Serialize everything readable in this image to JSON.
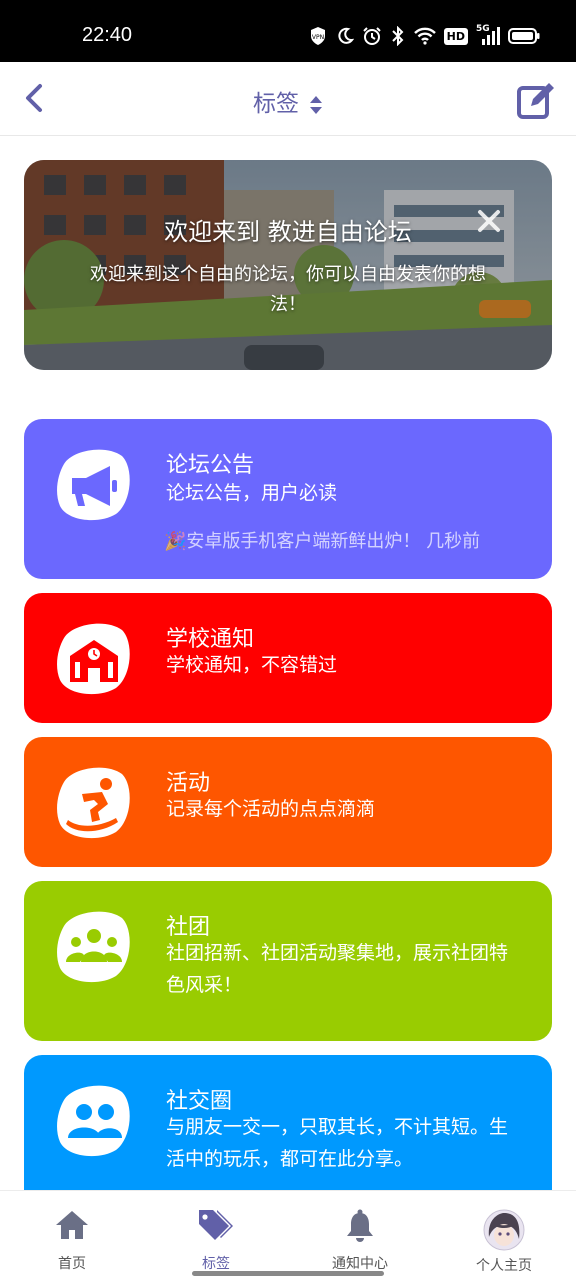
{
  "status_bar": {
    "time": "22:40",
    "icons": [
      "vpn-icon",
      "moon-icon",
      "alarm-icon",
      "bluetooth-icon",
      "wifi-icon",
      "hd-icon",
      "5g-signal-icon",
      "battery-icon"
    ],
    "hd_label": "HD",
    "network_label": "5G"
  },
  "header": {
    "title": "标签",
    "back_icon": "chevron-left-icon",
    "sort_icon": "sort-icon",
    "edit_icon": "edit-icon",
    "accent_color": "#6160a8"
  },
  "banner": {
    "title": "欢迎来到 教进自由论坛",
    "text": "欢迎来到这个自由的论坛，你可以自由发表你的想法！",
    "close_icon": "close-icon"
  },
  "categories": [
    {
      "title": "论坛公告",
      "desc": "论坛公告，用户必读",
      "latest": "🎉安卓版手机客户端新鲜出炉！ 几秒前",
      "icon": "megaphone-icon",
      "color": "#6b68fe"
    },
    {
      "title": "学校通知",
      "desc": "学校通知，不容错过",
      "icon": "school-icon",
      "color": "#ff0000"
    },
    {
      "title": "活动",
      "desc": "记录每个活动的点点滴滴",
      "icon": "snowboarder-icon",
      "color": "#fe5600"
    },
    {
      "title": "社团",
      "desc": "社团招新、社团活动聚集地，展示社团特色风采！",
      "icon": "group-icon",
      "color": "#99cc01"
    },
    {
      "title": "社交圈",
      "desc": "与朋友一交一，只取其长，不计其短。生活中的玩乐，都可在此分享。",
      "icon": "users-icon",
      "color": "#0099fe"
    }
  ],
  "tabbar": {
    "items": [
      {
        "label": "首页",
        "icon": "home-icon"
      },
      {
        "label": "标签",
        "icon": "tags-icon",
        "active": true
      },
      {
        "label": "通知中心",
        "icon": "bell-icon"
      },
      {
        "label": "个人主页",
        "icon": "avatar"
      }
    ],
    "active_color": "#6160a8",
    "inactive_color": "#6a6f86"
  }
}
